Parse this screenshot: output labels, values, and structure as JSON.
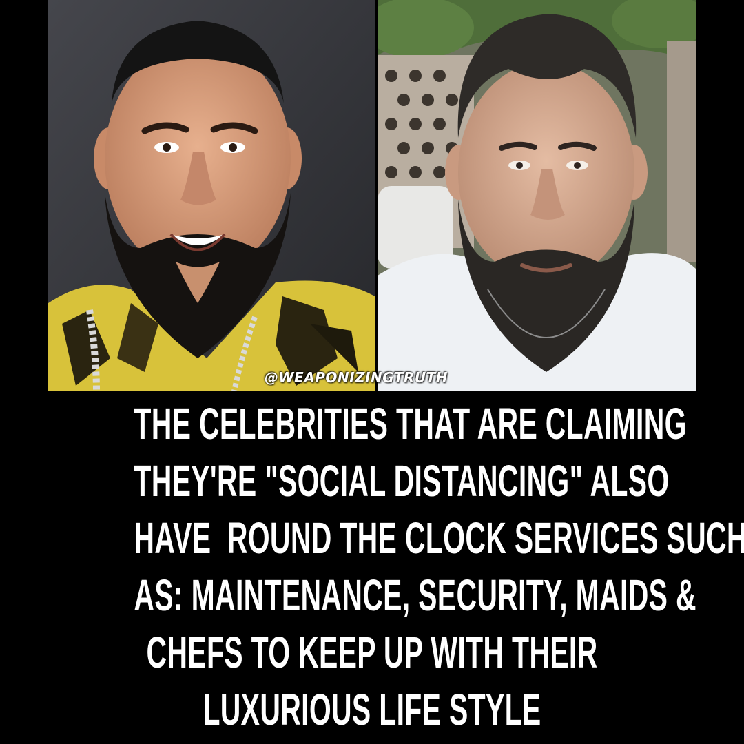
{
  "watermark": "@WEAPONIZINGTRUTH",
  "caption": {
    "lines": [
      "THE CELEBRITIES THAT ARE CLAIMING",
      "THEY'RE \"SOCIAL DISTANCING\" ALSO",
      "HAVE  ROUND THE CLOCK SERVICES SUCH",
      "AS: MAINTENANCE, SECURITY, MAIDS &",
      "CHEFS TO KEEP UP WITH THEIR",
      "LUXURIOUS LIFE STYLE"
    ]
  },
  "colors": {
    "background": "#000000",
    "caption_text": "#ffffff",
    "left_photo_backdrop": "#3a3b40",
    "jacket_yellow": "#d8c23a",
    "right_photo_foliage": "#4f6e3a",
    "shirt_white": "#eef1f4"
  }
}
